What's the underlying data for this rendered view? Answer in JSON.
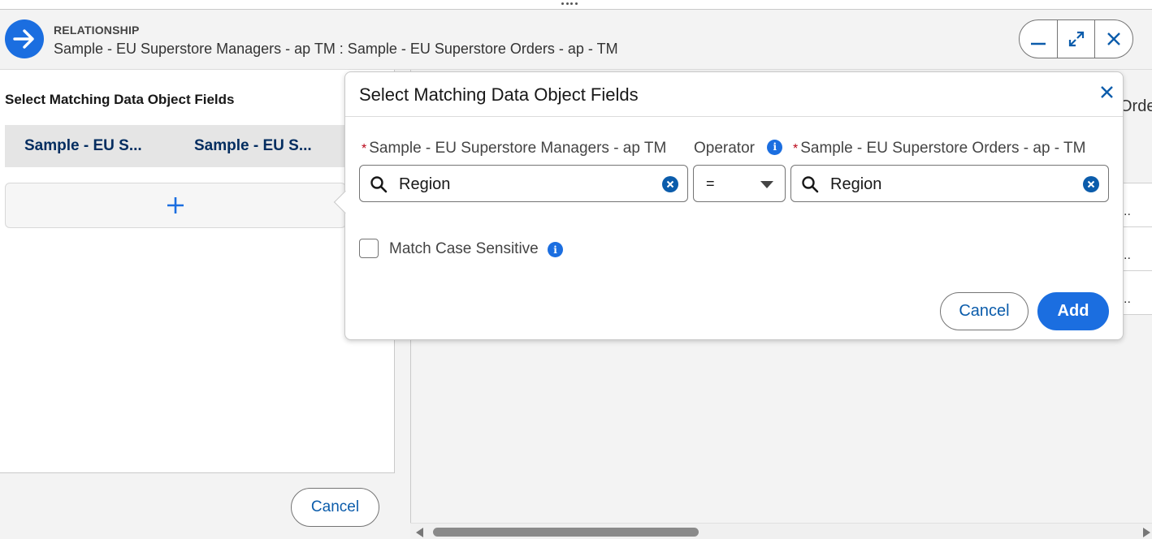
{
  "header": {
    "eyebrow": "RELATIONSHIP",
    "title": "Sample - EU Superstore Managers - ap TM : Sample - EU Superstore Orders - ap - TM"
  },
  "left": {
    "heading": "Select Matching Data Object Fields",
    "columns": [
      "Sample - EU S...",
      "Sample - EU S..."
    ],
    "add_symbol": "+",
    "cancel_label": "Cancel"
  },
  "right": {
    "header_text": "Orde",
    "cells": [
      "..",
      "..",
      ".."
    ]
  },
  "popover": {
    "title": "Select Matching Data Object Fields",
    "left_field": {
      "required_marker": "*",
      "label": "Sample - EU Superstore Managers - ap TM",
      "value": "Region"
    },
    "operator": {
      "label": "Operator",
      "value": "="
    },
    "right_field": {
      "required_marker": "*",
      "label": "Sample - EU Superstore Orders - ap - TM",
      "value": "Region"
    },
    "match_case": {
      "label": "Match Case Sensitive",
      "checked": false
    },
    "cancel_label": "Cancel",
    "add_label": "Add"
  },
  "colors": {
    "brand": "#1b6ee0",
    "link": "#0b5cab",
    "heading": "#032d60",
    "required": "#ba0517"
  }
}
